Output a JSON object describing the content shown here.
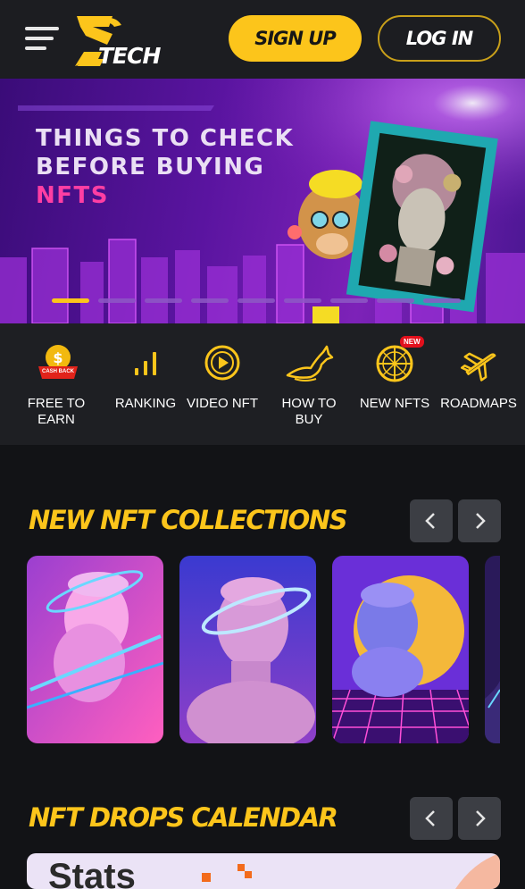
{
  "header": {
    "logo_text": "TECH",
    "signup_label": "SIGN UP",
    "login_label": "LOG IN"
  },
  "hero": {
    "line1": "THINGS TO CHECK",
    "line2": "BEFORE BUYING",
    "line3": "NFTS",
    "slide_count": 9,
    "active_slide": 1
  },
  "categories": [
    {
      "label": "FREE TO EARN",
      "icon": "cashback-coin-icon",
      "badge_text": "CASH BACK"
    },
    {
      "label": "RANKING",
      "icon": "ranking-bars-icon"
    },
    {
      "label": "VIDEO NFT",
      "icon": "play-circle-icon"
    },
    {
      "label": "HOW TO BUY",
      "icon": "horse-icon"
    },
    {
      "label": "NEW NFTS",
      "icon": "globe-icon",
      "badge": "NEW"
    },
    {
      "label": "ROADMAPS",
      "icon": "airplane-icon"
    }
  ],
  "sections": {
    "collections_title": "NEW NFT COLLECTIONS",
    "drops_title": "NFT DROPS CALENDAR"
  },
  "collections": [
    {
      "image": "pink-statue-with-neon-ring"
    },
    {
      "image": "purple-statue-with-halo"
    },
    {
      "image": "blue-statue-on-retro-grid"
    },
    {
      "image": "partially-visible-card"
    }
  ],
  "drops": {
    "card_text": "Stats"
  },
  "colors": {
    "accent": "#fcc51b",
    "background": "#121316",
    "header_bg": "#1c1d21",
    "nav_bg": "#1e1f23",
    "hero_pink": "#ff3ea3"
  }
}
